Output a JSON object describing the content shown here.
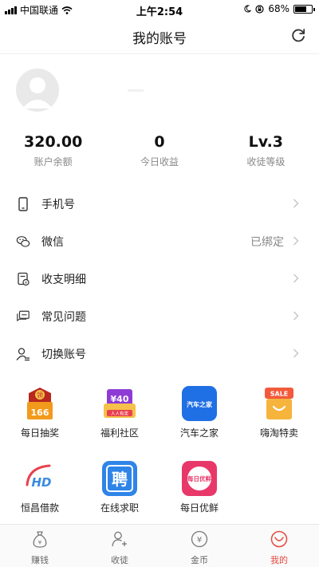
{
  "status_bar": {
    "carrier": "中国联通",
    "time": "上午2:54",
    "battery": "68%",
    "battery_level": 0.68
  },
  "nav": {
    "title": "我的账号",
    "refresh_icon": "refresh-icon"
  },
  "profile": {
    "avatar_icon": "avatar-placeholder"
  },
  "stats": [
    {
      "value": "320.00",
      "label": "账户余额"
    },
    {
      "value": "0",
      "label": "今日收益"
    },
    {
      "value": "Lv.3",
      "label": "收徒等级"
    }
  ],
  "menu": [
    {
      "icon": "phone-icon",
      "title": "手机号",
      "extra": ""
    },
    {
      "icon": "wechat-icon",
      "title": "微信",
      "extra": "已绑定"
    },
    {
      "icon": "bill-icon",
      "title": "收支明细",
      "extra": ""
    },
    {
      "icon": "faq-icon",
      "title": "常见问题",
      "extra": ""
    },
    {
      "icon": "switch-account-icon",
      "title": "切换账号",
      "extra": ""
    }
  ],
  "apps": [
    {
      "label": "每日抽奖",
      "badge_top": "领",
      "badge_bottom": "166",
      "color": "#f29a1b"
    },
    {
      "label": "福利社区",
      "badge_top": "¥40",
      "badge_bottom": "人人有奖",
      "color": "#e8404f"
    },
    {
      "label": "汽车之家",
      "badge_top": "汽车之家",
      "color": "#1f6fe5"
    },
    {
      "label": "嗨淘特卖",
      "badge_top": "SALE",
      "color": "#f25a3c"
    },
    {
      "label": "恒昌借款",
      "badge_top": "HD",
      "color": "#3a8be0"
    },
    {
      "label": "在线求职",
      "badge_top": "聘",
      "color": "#2f84e8"
    },
    {
      "label": "每日优鲜",
      "badge_top": "每日优鲜",
      "color": "#e8386a"
    }
  ],
  "tabs": [
    {
      "label": "赚钱",
      "icon": "money-bag-icon",
      "active": false
    },
    {
      "label": "收徒",
      "icon": "add-user-icon",
      "active": false
    },
    {
      "label": "金币",
      "icon": "coin-icon",
      "active": false
    },
    {
      "label": "我的",
      "icon": "smile-icon",
      "active": true
    }
  ],
  "colors": {
    "accent": "#e5483d",
    "muted": "#888888",
    "divider": "#eeeeee"
  }
}
